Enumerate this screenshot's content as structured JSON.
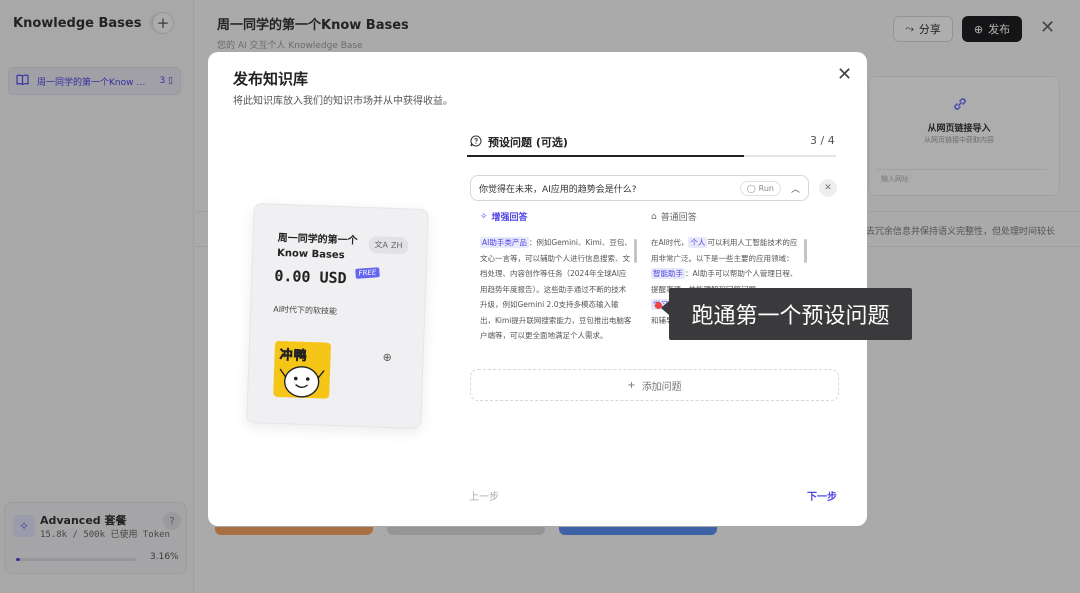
{
  "sidebar": {
    "title": "Knowledge Bases",
    "help": "?",
    "add": "+",
    "items": [
      {
        "label": "周一同学的第一个Know …",
        "count": "3"
      }
    ],
    "plan": {
      "title": "Advanced 套餐",
      "usage": "15.8k / 500k 已使用 Token",
      "percent_text": "3.16%",
      "percent_value": 3.16,
      "help": "?"
    }
  },
  "header": {
    "title": "周一同学的第一个Know Bases",
    "subtitle": "您的 AI 交互个人 Knowledge Base",
    "share_label": "分享",
    "publish_label": "发布"
  },
  "background": {
    "import_title": "从网页链接导入",
    "import_sub": "从网页链接中获取内容",
    "import_input_placeholder": "输入网址",
    "note": "去冗余信息并保持语义完整性，但处理时间较长"
  },
  "modal": {
    "title": "发布知识库",
    "subtitle": "将此知识库放入我们的知识市场并从中获得收益。",
    "preview": {
      "title": "周一同学的第一个Know Bases",
      "language": "ZH",
      "price": "0.00 USD",
      "free_badge": "FREE",
      "description": "AI时代下的软技能",
      "logo_text": "冲鸭"
    },
    "step": {
      "title": "预设问题 (可选)",
      "counter": "3 / 4",
      "progress": 0.75
    },
    "question": "你觉得在未来，AI应用的趋势会是什么?",
    "run_label": "Run",
    "enhanced": {
      "header": "增强回答",
      "tag": "AI助手类产品",
      "text": "：例如Gemini、Kimi、豆包、文心一言等，可以辅助个人进行信息搜索、文档处理、内容创作等任务（2024年全球AI应用趋势年度报告）。这些助手通过不断的技术升级，例如Gemini 2.0支持多模态输入输出，Kimi提升联网搜索能力，豆包推出电脑客户端等，可以更全面地满足个人需求。"
    },
    "normal": {
      "header": "普通回答",
      "intro_pre": "在AI时代，",
      "intro_tag": "个人",
      "intro_post": "可以利用人工智能技术的应用非常广泛。以下是一些主要的应用领域：",
      "item1_tag": "智能助手",
      "item1_text": "：AI助手可以帮助个人管理日程、提醒事项，并能理解和回答问题。",
      "item2_tag": "学习与教育",
      "item2_text": "：AI能够提供个性化的学习建议和辅导。"
    },
    "add_question_label": "添加问题",
    "prev_label": "上一步",
    "next_label": "下一步"
  },
  "callout": {
    "text": "跑通第一个预设问题"
  }
}
